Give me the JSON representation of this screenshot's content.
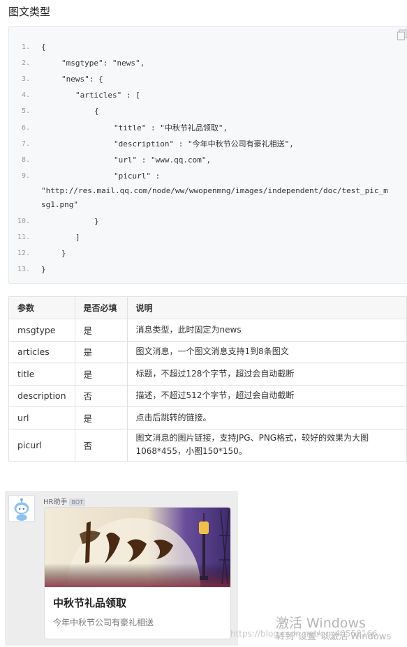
{
  "section_title": "图文类型",
  "code": {
    "lines": [
      {
        "n": "1.",
        "text": "{",
        "indent": 0
      },
      {
        "n": "2.",
        "text": "\"msgtype\": \"news\",",
        "indent": 1
      },
      {
        "n": "3.",
        "text": "\"news\": {",
        "indent": 1
      },
      {
        "n": "4.",
        "text": "\"articles\" : [",
        "indent": 2
      },
      {
        "n": "5.",
        "text": "{",
        "indent": 3
      },
      {
        "n": "6.",
        "text": "\"title\" : \"中秋节礼品领取\",",
        "indent": 4
      },
      {
        "n": "7.",
        "text": "\"description\" : \"今年中秋节公司有豪礼相送\",",
        "indent": 4
      },
      {
        "n": "8.",
        "text": "\"url\" : \"www.qq.com\",",
        "indent": 4
      },
      {
        "n": "9.",
        "text": "\"picurl\" :",
        "indent": 4
      },
      {
        "n": "",
        "text": "\"http://res.mail.qq.com/node/ww/wwopenmng/images/independent/doc/test_pic_m",
        "indent": 0
      },
      {
        "n": "",
        "text": "sg1.png\"",
        "indent": 0
      },
      {
        "n": "10.",
        "text": "}",
        "indent": 3
      },
      {
        "n": "11.",
        "text": "]",
        "indent": 2
      },
      {
        "n": "12.",
        "text": "}",
        "indent": 1
      },
      {
        "n": "13.",
        "text": "}",
        "indent": 0
      }
    ]
  },
  "table": {
    "headers": [
      "参数",
      "是否必填",
      "说明"
    ],
    "rows": [
      {
        "param": "msgtype",
        "required": "是",
        "desc": "消息类型，此时固定为news"
      },
      {
        "param": "articles",
        "required": "是",
        "desc": "图文消息，一个图文消息支持1到8条图文"
      },
      {
        "param": "title",
        "required": "是",
        "desc": "标题，不超过128个字节，超过会自动截断"
      },
      {
        "param": "description",
        "required": "否",
        "desc": "描述，不超过512个字节，超过会自动截断"
      },
      {
        "param": "url",
        "required": "是",
        "desc": "点击后跳转的链接。"
      },
      {
        "param": "picurl",
        "required": "否",
        "desc1": "图文消息的图片链接，支持JPG、PNG格式，较好的效果为大图",
        "desc2": "1068*455，小图150*150。"
      }
    ]
  },
  "preview": {
    "sender": "HR助手",
    "badge": "BOT",
    "banner_text": "中秋豪礼",
    "card_title": "中秋节礼品领取",
    "card_desc": "今年中秋节公司有豪礼相送"
  },
  "watermark": {
    "windows_line1": "激活 Windows",
    "windows_line2": "转到\"设置\"以激活 Windows",
    "url": "https://blog.csdn.net/qq_40558166"
  },
  "colors": {
    "code_bg": "#f6f8fa",
    "banner_purple": "#5a3f8a",
    "banner_moon": "#f4ead2"
  }
}
